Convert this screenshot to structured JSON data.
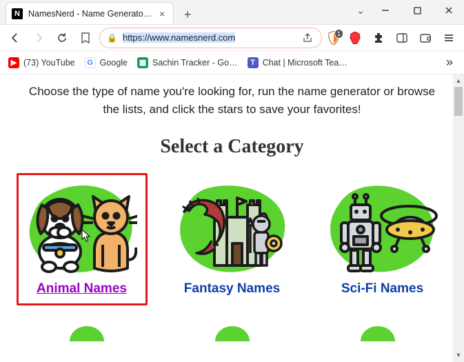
{
  "browser": {
    "tab_title": "NamesNerd - Name Generators f…",
    "favicon_letter": "N",
    "url_display": "https://www.namesnerd.com",
    "shield_count": "1"
  },
  "bookmarks": {
    "youtube": "(73) YouTube",
    "google": "Google",
    "sheets": "Sachin Tracker - Go…",
    "teams": "Chat | Microsoft Tea…"
  },
  "page": {
    "intro": "Choose the type of name you're looking for, run the name generator or browse the lists, and click the stars to save your favorites!",
    "heading": "Select a Category",
    "categories": [
      {
        "label": "Animal Names",
        "slug": "animal"
      },
      {
        "label": "Fantasy Names",
        "slug": "fantasy"
      },
      {
        "label": "Sci-Fi Names",
        "slug": "scifi"
      }
    ]
  }
}
